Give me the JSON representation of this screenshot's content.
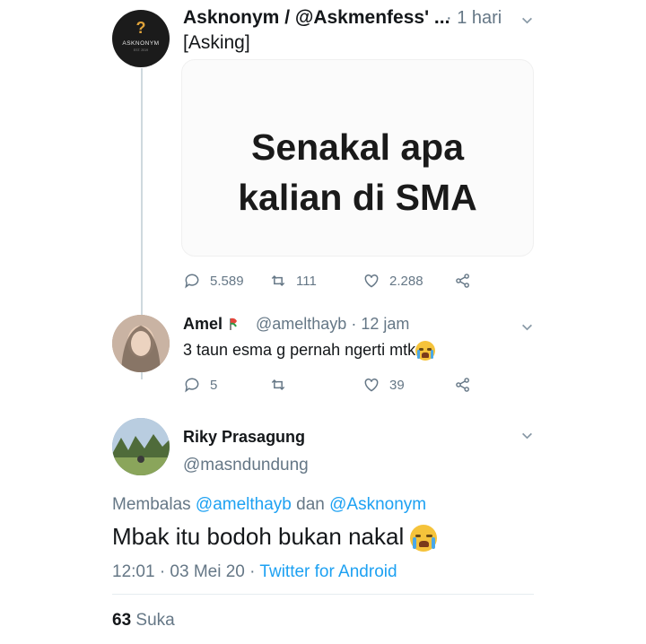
{
  "tweet1": {
    "name": "Asknonym / @Askmenfess' ...",
    "time": "· 1 hari",
    "tag": "[Asking]",
    "avatar": {
      "symbol": "?",
      "brand": "ASKNONYM",
      "est": "EST. 2019"
    },
    "card_line1": "Senakal apa",
    "card_line2": "kalian di SMA",
    "stats": {
      "replies": "5.589",
      "retweets": "111",
      "likes": "2.288"
    }
  },
  "tweet2": {
    "name": "Amel",
    "handle": "@amelthayb · 12 jam",
    "text": "3 taun esma g pernah ngerti mtk",
    "stats": {
      "replies": "5",
      "likes": "39"
    }
  },
  "tweet3": {
    "name": "Riky Prasagung",
    "handle": "@masndundung",
    "reply_prefix": "Membalas ",
    "reply_user1": "@amelthayb",
    "reply_and": " dan ",
    "reply_user2": "@Asknonym",
    "text": "Mbak itu bodoh bukan nakal",
    "timestamp": "12:01 · 03 Mei 20 · ",
    "source": "Twitter for Android",
    "likes_count": "63",
    "likes_label": " Suka"
  },
  "icons": [
    "reply-icon",
    "retweet-icon",
    "like-icon",
    "share-icon",
    "chevron-down-icon",
    "crying-emoji-icon"
  ],
  "colors": {
    "link": "#1da1f2",
    "muted": "#657786",
    "text": "#14171a"
  }
}
